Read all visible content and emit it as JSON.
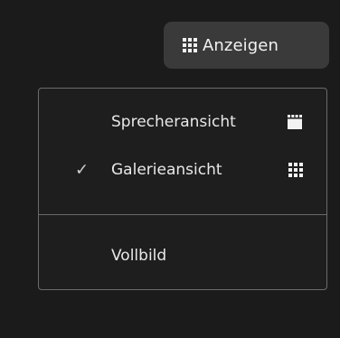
{
  "toolbar": {
    "view_button_label": "Anzeigen",
    "view_button_icon": "grid-icon"
  },
  "view_menu": {
    "items": [
      {
        "label": "Sprecheransicht",
        "icon": "speaker-view-icon",
        "checked": false
      },
      {
        "label": "Galerieansicht",
        "icon": "gallery-grid-icon",
        "checked": true
      },
      {
        "label": "Vollbild",
        "icon": "",
        "checked": false
      }
    ],
    "check_glyph": "✓"
  },
  "colors": {
    "background": "#1b1b1b",
    "button_bg": "#3a3a3a",
    "menu_border": "#6b6b6b",
    "text": "#e8e8e8"
  }
}
